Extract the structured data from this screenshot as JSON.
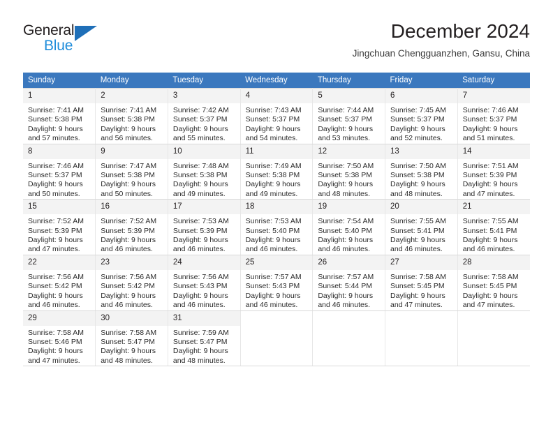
{
  "brand": {
    "name_part1": "General",
    "name_part2": "Blue",
    "triangle_icon": "triangle-icon",
    "accent_dark": "#1f6fb8",
    "accent_light": "#1f8ddb"
  },
  "header": {
    "title": "December 2024",
    "subtitle": "Jingchuan Chengguanzhen, Gansu, China"
  },
  "theme": {
    "header_bar": "#3b78be",
    "daynum_band": "#f3f3f3",
    "grid_line": "#d9d9d9",
    "text": "#231f20"
  },
  "weekday_headers": [
    "Sunday",
    "Monday",
    "Tuesday",
    "Wednesday",
    "Thursday",
    "Friday",
    "Saturday"
  ],
  "weeks": [
    [
      {
        "day": "1",
        "sunrise": "Sunrise: 7:41 AM",
        "sunset": "Sunset: 5:38 PM",
        "daylight_line1": "Daylight: 9 hours",
        "daylight_line2": "and 57 minutes."
      },
      {
        "day": "2",
        "sunrise": "Sunrise: 7:41 AM",
        "sunset": "Sunset: 5:38 PM",
        "daylight_line1": "Daylight: 9 hours",
        "daylight_line2": "and 56 minutes."
      },
      {
        "day": "3",
        "sunrise": "Sunrise: 7:42 AM",
        "sunset": "Sunset: 5:37 PM",
        "daylight_line1": "Daylight: 9 hours",
        "daylight_line2": "and 55 minutes."
      },
      {
        "day": "4",
        "sunrise": "Sunrise: 7:43 AM",
        "sunset": "Sunset: 5:37 PM",
        "daylight_line1": "Daylight: 9 hours",
        "daylight_line2": "and 54 minutes."
      },
      {
        "day": "5",
        "sunrise": "Sunrise: 7:44 AM",
        "sunset": "Sunset: 5:37 PM",
        "daylight_line1": "Daylight: 9 hours",
        "daylight_line2": "and 53 minutes."
      },
      {
        "day": "6",
        "sunrise": "Sunrise: 7:45 AM",
        "sunset": "Sunset: 5:37 PM",
        "daylight_line1": "Daylight: 9 hours",
        "daylight_line2": "and 52 minutes."
      },
      {
        "day": "7",
        "sunrise": "Sunrise: 7:46 AM",
        "sunset": "Sunset: 5:37 PM",
        "daylight_line1": "Daylight: 9 hours",
        "daylight_line2": "and 51 minutes."
      }
    ],
    [
      {
        "day": "8",
        "sunrise": "Sunrise: 7:46 AM",
        "sunset": "Sunset: 5:37 PM",
        "daylight_line1": "Daylight: 9 hours",
        "daylight_line2": "and 50 minutes."
      },
      {
        "day": "9",
        "sunrise": "Sunrise: 7:47 AM",
        "sunset": "Sunset: 5:38 PM",
        "daylight_line1": "Daylight: 9 hours",
        "daylight_line2": "and 50 minutes."
      },
      {
        "day": "10",
        "sunrise": "Sunrise: 7:48 AM",
        "sunset": "Sunset: 5:38 PM",
        "daylight_line1": "Daylight: 9 hours",
        "daylight_line2": "and 49 minutes."
      },
      {
        "day": "11",
        "sunrise": "Sunrise: 7:49 AM",
        "sunset": "Sunset: 5:38 PM",
        "daylight_line1": "Daylight: 9 hours",
        "daylight_line2": "and 49 minutes."
      },
      {
        "day": "12",
        "sunrise": "Sunrise: 7:50 AM",
        "sunset": "Sunset: 5:38 PM",
        "daylight_line1": "Daylight: 9 hours",
        "daylight_line2": "and 48 minutes."
      },
      {
        "day": "13",
        "sunrise": "Sunrise: 7:50 AM",
        "sunset": "Sunset: 5:38 PM",
        "daylight_line1": "Daylight: 9 hours",
        "daylight_line2": "and 48 minutes."
      },
      {
        "day": "14",
        "sunrise": "Sunrise: 7:51 AM",
        "sunset": "Sunset: 5:39 PM",
        "daylight_line1": "Daylight: 9 hours",
        "daylight_line2": "and 47 minutes."
      }
    ],
    [
      {
        "day": "15",
        "sunrise": "Sunrise: 7:52 AM",
        "sunset": "Sunset: 5:39 PM",
        "daylight_line1": "Daylight: 9 hours",
        "daylight_line2": "and 47 minutes."
      },
      {
        "day": "16",
        "sunrise": "Sunrise: 7:52 AM",
        "sunset": "Sunset: 5:39 PM",
        "daylight_line1": "Daylight: 9 hours",
        "daylight_line2": "and 46 minutes."
      },
      {
        "day": "17",
        "sunrise": "Sunrise: 7:53 AM",
        "sunset": "Sunset: 5:39 PM",
        "daylight_line1": "Daylight: 9 hours",
        "daylight_line2": "and 46 minutes."
      },
      {
        "day": "18",
        "sunrise": "Sunrise: 7:53 AM",
        "sunset": "Sunset: 5:40 PM",
        "daylight_line1": "Daylight: 9 hours",
        "daylight_line2": "and 46 minutes."
      },
      {
        "day": "19",
        "sunrise": "Sunrise: 7:54 AM",
        "sunset": "Sunset: 5:40 PM",
        "daylight_line1": "Daylight: 9 hours",
        "daylight_line2": "and 46 minutes."
      },
      {
        "day": "20",
        "sunrise": "Sunrise: 7:55 AM",
        "sunset": "Sunset: 5:41 PM",
        "daylight_line1": "Daylight: 9 hours",
        "daylight_line2": "and 46 minutes."
      },
      {
        "day": "21",
        "sunrise": "Sunrise: 7:55 AM",
        "sunset": "Sunset: 5:41 PM",
        "daylight_line1": "Daylight: 9 hours",
        "daylight_line2": "and 46 minutes."
      }
    ],
    [
      {
        "day": "22",
        "sunrise": "Sunrise: 7:56 AM",
        "sunset": "Sunset: 5:42 PM",
        "daylight_line1": "Daylight: 9 hours",
        "daylight_line2": "and 46 minutes."
      },
      {
        "day": "23",
        "sunrise": "Sunrise: 7:56 AM",
        "sunset": "Sunset: 5:42 PM",
        "daylight_line1": "Daylight: 9 hours",
        "daylight_line2": "and 46 minutes."
      },
      {
        "day": "24",
        "sunrise": "Sunrise: 7:56 AM",
        "sunset": "Sunset: 5:43 PM",
        "daylight_line1": "Daylight: 9 hours",
        "daylight_line2": "and 46 minutes."
      },
      {
        "day": "25",
        "sunrise": "Sunrise: 7:57 AM",
        "sunset": "Sunset: 5:43 PM",
        "daylight_line1": "Daylight: 9 hours",
        "daylight_line2": "and 46 minutes."
      },
      {
        "day": "26",
        "sunrise": "Sunrise: 7:57 AM",
        "sunset": "Sunset: 5:44 PM",
        "daylight_line1": "Daylight: 9 hours",
        "daylight_line2": "and 46 minutes."
      },
      {
        "day": "27",
        "sunrise": "Sunrise: 7:58 AM",
        "sunset": "Sunset: 5:45 PM",
        "daylight_line1": "Daylight: 9 hours",
        "daylight_line2": "and 47 minutes."
      },
      {
        "day": "28",
        "sunrise": "Sunrise: 7:58 AM",
        "sunset": "Sunset: 5:45 PM",
        "daylight_line1": "Daylight: 9 hours",
        "daylight_line2": "and 47 minutes."
      }
    ],
    [
      {
        "day": "29",
        "sunrise": "Sunrise: 7:58 AM",
        "sunset": "Sunset: 5:46 PM",
        "daylight_line1": "Daylight: 9 hours",
        "daylight_line2": "and 47 minutes."
      },
      {
        "day": "30",
        "sunrise": "Sunrise: 7:58 AM",
        "sunset": "Sunset: 5:47 PM",
        "daylight_line1": "Daylight: 9 hours",
        "daylight_line2": "and 48 minutes."
      },
      {
        "day": "31",
        "sunrise": "Sunrise: 7:59 AM",
        "sunset": "Sunset: 5:47 PM",
        "daylight_line1": "Daylight: 9 hours",
        "daylight_line2": "and 48 minutes."
      },
      {
        "day": "",
        "sunrise": "",
        "sunset": "",
        "daylight_line1": "",
        "daylight_line2": ""
      },
      {
        "day": "",
        "sunrise": "",
        "sunset": "",
        "daylight_line1": "",
        "daylight_line2": ""
      },
      {
        "day": "",
        "sunrise": "",
        "sunset": "",
        "daylight_line1": "",
        "daylight_line2": ""
      },
      {
        "day": "",
        "sunrise": "",
        "sunset": "",
        "daylight_line1": "",
        "daylight_line2": ""
      }
    ]
  ]
}
